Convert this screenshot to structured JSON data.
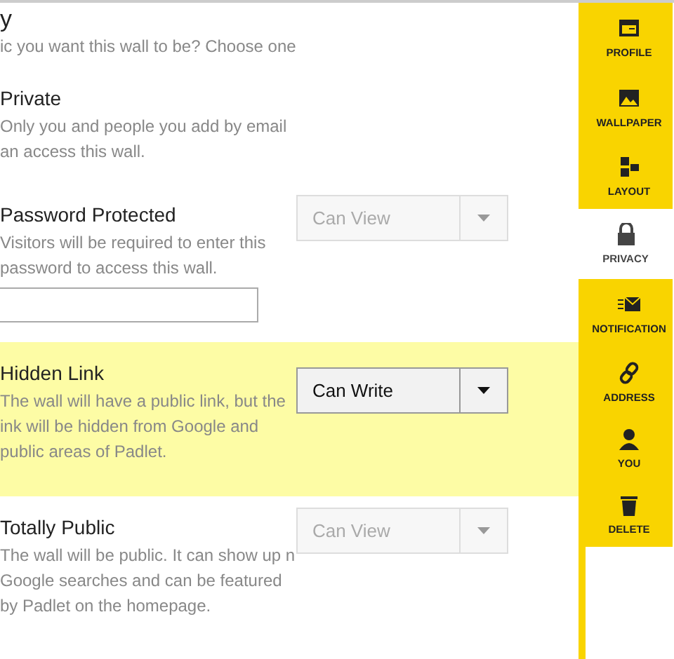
{
  "heading": "y",
  "subtitle": "ic you want this wall to be? Choose one",
  "options": [
    {
      "title": "Private",
      "description": "Only you and people you add by email an access this wall.",
      "selected": false
    },
    {
      "title": "Password Protected",
      "description": "Visitors will be required to enter this password to access this wall.",
      "selected": false,
      "dropdown": {
        "value": "Can View",
        "disabled": true
      },
      "password_field": true
    },
    {
      "title": "Hidden Link",
      "description": "The wall will have a public link, but the ink will be hidden from Google and public areas of Padlet.",
      "selected": true,
      "dropdown": {
        "value": "Can Write",
        "disabled": false
      }
    },
    {
      "title": "Totally Public",
      "description": "The wall will be public. It can show up n Google searches and can be featured by Padlet on the homepage.",
      "selected": false,
      "dropdown": {
        "value": "Can View",
        "disabled": true
      }
    }
  ],
  "sidebar": {
    "items": [
      {
        "kind": "profile",
        "label": "PROFILE",
        "selected": false
      },
      {
        "kind": "wallpaper",
        "label": "WALLPAPER",
        "selected": false
      },
      {
        "kind": "layout",
        "label": "LAYOUT",
        "selected": false
      },
      {
        "kind": "privacy",
        "label": "PRIVACY",
        "selected": true
      },
      {
        "kind": "notification",
        "label": "NOTIFICATION",
        "selected": false
      },
      {
        "kind": "address",
        "label": "ADDRESS",
        "selected": false
      },
      {
        "kind": "you",
        "label": "YOU",
        "selected": false
      },
      {
        "kind": "delete",
        "label": "DELETE",
        "selected": false
      }
    ]
  }
}
